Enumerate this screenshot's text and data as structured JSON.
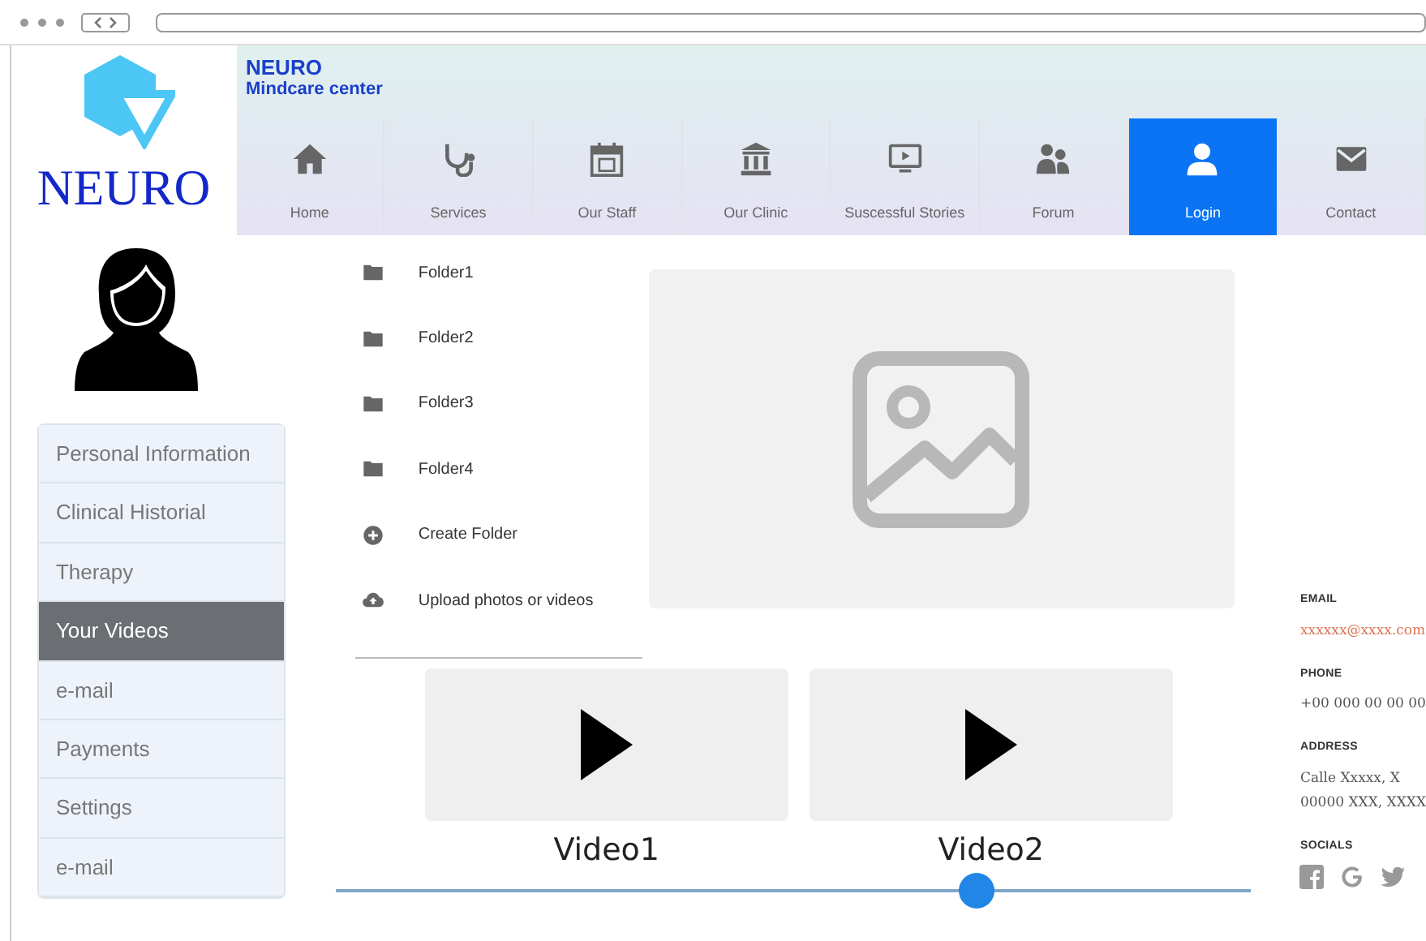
{
  "brand": {
    "logo_text": "NEURO",
    "title": "NEURO",
    "subtitle": "Mindcare center"
  },
  "nav": [
    {
      "label": "Home",
      "selected": false
    },
    {
      "label": "Services",
      "selected": false
    },
    {
      "label": "Our Staff",
      "selected": false
    },
    {
      "label": "Our Clinic",
      "selected": false
    },
    {
      "label": "Suscessful Stories",
      "selected": false
    },
    {
      "label": "Forum",
      "selected": false
    },
    {
      "label": "Login",
      "selected": true
    },
    {
      "label": "Contact",
      "selected": false
    }
  ],
  "sidebar": {
    "items": [
      {
        "label": "Personal Information",
        "selected": false
      },
      {
        "label": "Clinical Historial",
        "selected": false
      },
      {
        "label": "Therapy",
        "selected": false
      },
      {
        "label": "Your Videos",
        "selected": true
      },
      {
        "label": "e-mail",
        "selected": false
      },
      {
        "label": "Payments",
        "selected": false
      },
      {
        "label": "Settings",
        "selected": false
      },
      {
        "label": "e-mail",
        "selected": false
      }
    ]
  },
  "files": [
    {
      "label": "Folder1",
      "kind": "folder"
    },
    {
      "label": "Folder2",
      "kind": "folder"
    },
    {
      "label": "Folder3",
      "kind": "folder"
    },
    {
      "label": "Folder4",
      "kind": "folder"
    },
    {
      "label": "Create Folder",
      "kind": "create"
    },
    {
      "label": "Upload photos or videos",
      "kind": "upload"
    }
  ],
  "videos": [
    {
      "title": "Video1"
    },
    {
      "title": "Video2"
    }
  ],
  "slider": {
    "level": 0.7
  },
  "contact": [
    {
      "heading": "EMAIL",
      "lines": [
        "xxxxxx@xxxx.com"
      ],
      "kind": "link"
    },
    {
      "heading": "PHONE",
      "lines": [
        "+00 000 00 00 00"
      ],
      "kind": "text"
    },
    {
      "heading": "ADDRESS",
      "lines": [
        "Calle Xxxxx, X",
        "00000 XXX, XXXX"
      ],
      "kind": "text"
    },
    {
      "heading": "SOCIALS",
      "kind": "socials"
    }
  ]
}
